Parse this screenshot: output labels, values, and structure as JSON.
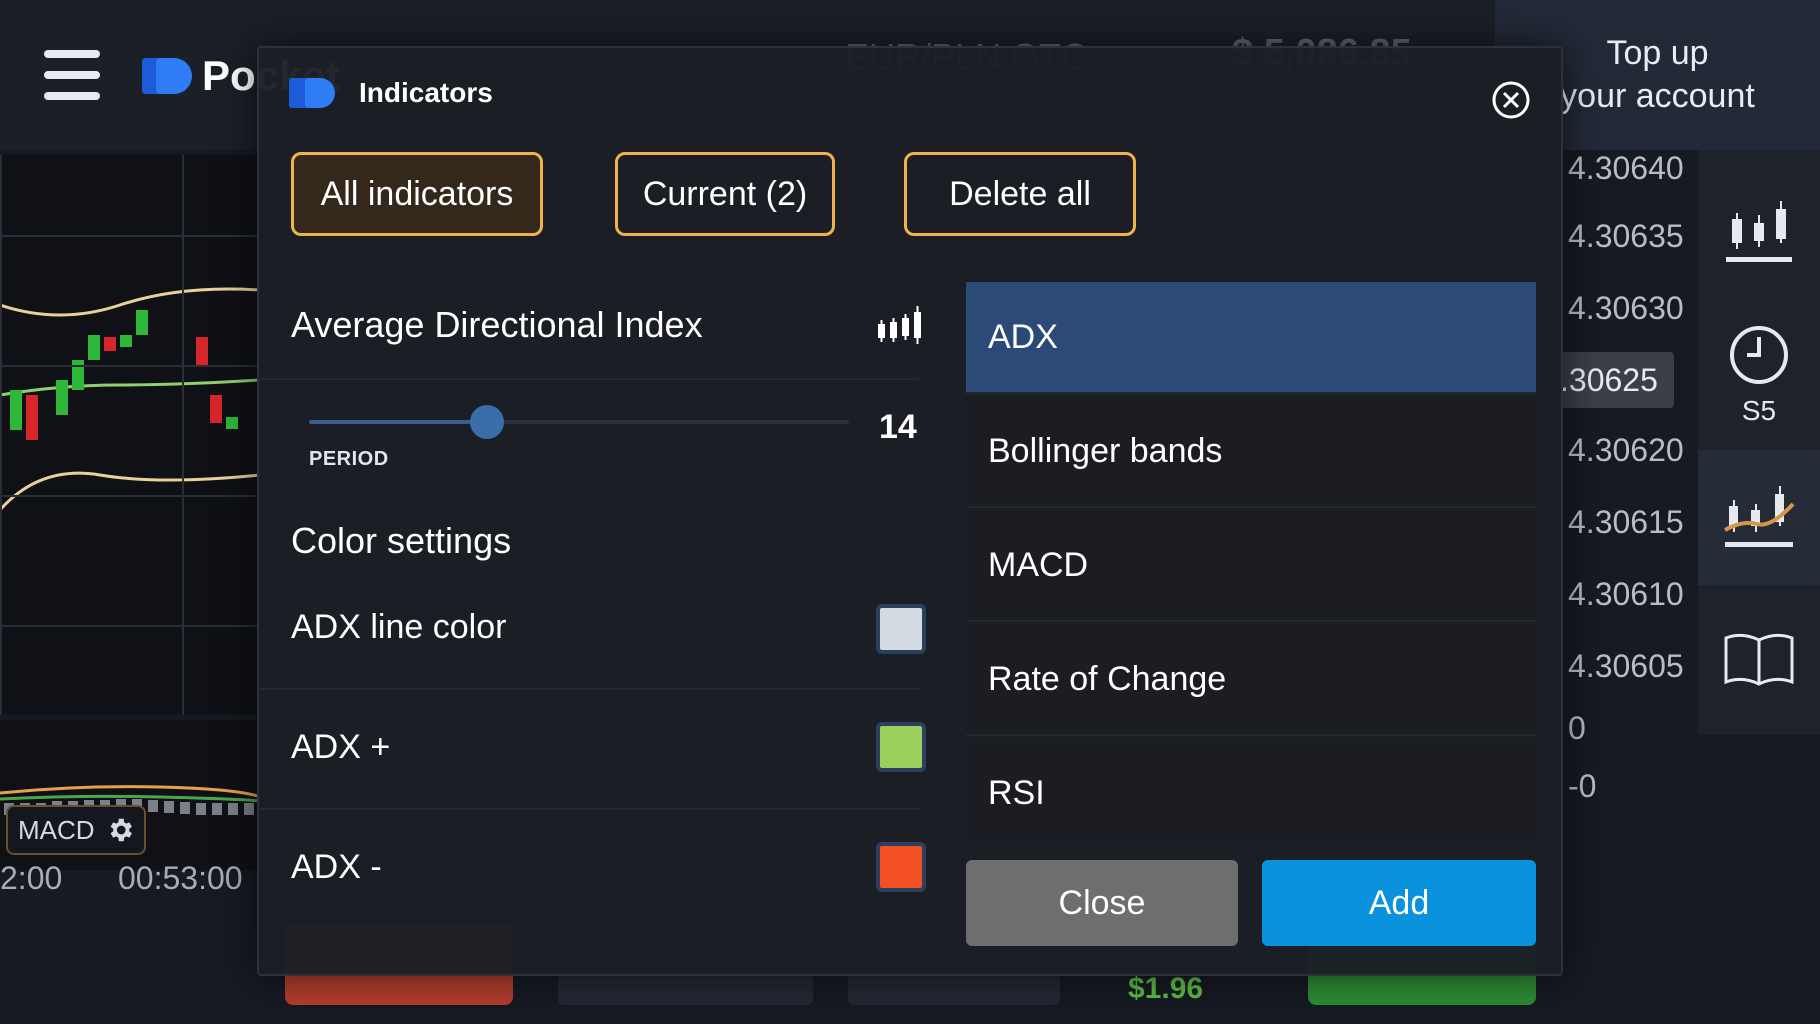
{
  "app": {
    "brand": "Pocket",
    "asset": "EUR/PLN OTC",
    "balance": "$ 5,086.85",
    "top_up_line1": "Top up",
    "top_up_line2": "your account"
  },
  "chart": {
    "price_ticks": [
      "4.30640",
      "4.30635",
      "4.30630",
      "4.30625",
      "4.30620",
      "4.30615",
      "4.30610",
      "4.30605",
      "0",
      "-0"
    ],
    "current_price": ".30625",
    "time_ticks": [
      "2:00",
      "00:53:00"
    ],
    "macd_badge": "MACD"
  },
  "side_tools": {
    "timeframe_label": "S5"
  },
  "trade_bar": {
    "payout": "$1.96"
  },
  "modal": {
    "title": "Indicators",
    "tabs": [
      {
        "label": "All indicators",
        "active": true
      },
      {
        "label": "Current (2)",
        "active": false
      },
      {
        "label": "Delete all",
        "active": false
      }
    ],
    "settings": {
      "indicator_name": "Average Directional Index",
      "period_label": "PERIOD",
      "period_value": "14",
      "period_fraction": 0.33,
      "color_section_title": "Color settings",
      "colors": [
        {
          "label": "ADX line color",
          "color": "#d3dbe3"
        },
        {
          "label": "ADX +",
          "color": "#9bcf5c"
        },
        {
          "label": "ADX -",
          "color": "#f25022"
        }
      ]
    },
    "list": [
      {
        "label": "ADX",
        "selected": true
      },
      {
        "label": "Bollinger bands",
        "selected": false
      },
      {
        "label": "MACD",
        "selected": false
      },
      {
        "label": "Rate of Change",
        "selected": false
      },
      {
        "label": "RSI",
        "selected": false
      }
    ],
    "close_label": "Close",
    "add_label": "Add"
  },
  "colors": {
    "accent_orange": "#f0b24a",
    "selected_blue": "#2c4a77",
    "add_blue": "#0a93dc",
    "sell_red": "#b33e2e",
    "buy_green": "#2d8c36"
  }
}
